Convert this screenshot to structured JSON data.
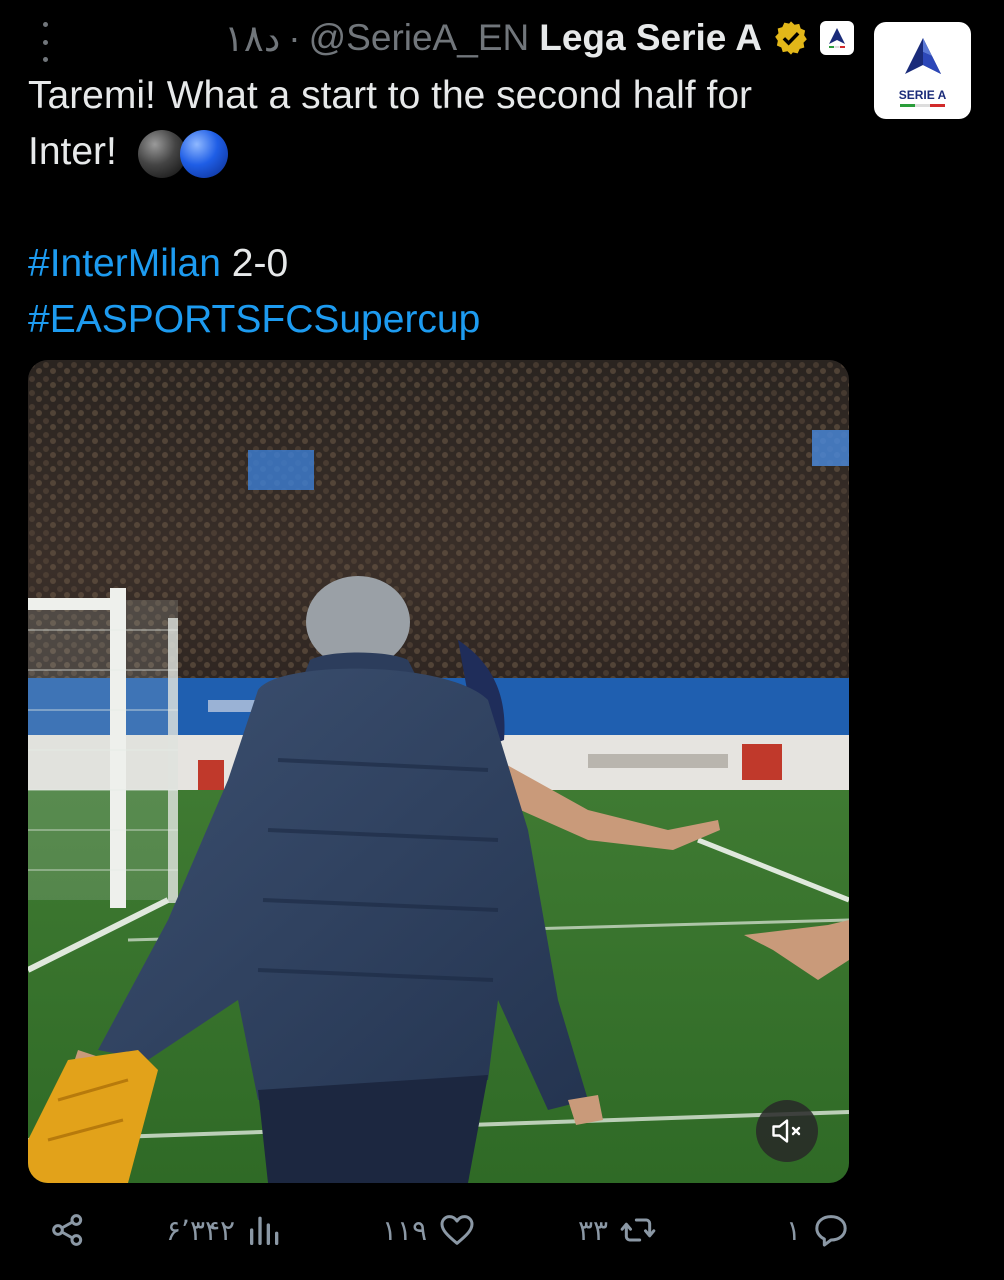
{
  "header": {
    "time": "۱۸د",
    "separator": "·",
    "handle": "@SerieA_EN",
    "display_name": "Lega Serie A"
  },
  "avatar": {
    "label": "SERIE A"
  },
  "tweet": {
    "line1": "Taremi! What a start to the second half for",
    "line2": "Inter!",
    "hashtag1": "#InterMilan",
    "score": " 2-0",
    "hashtag2": "#EASPORTSFCSupercup"
  },
  "actions": {
    "views": "۶٬۳۴۲",
    "likes": "۱۱۹",
    "reposts": "۳۳",
    "replies": "۱"
  },
  "colors": {
    "background": "#000000",
    "link": "#1d9bf0",
    "muted": "#71767b",
    "verified": "#e2b719"
  },
  "icons": [
    "more-vertical-icon",
    "verified-badge-icon",
    "share-icon",
    "views-icon",
    "like-icon",
    "repost-icon",
    "reply-icon",
    "volume-muted-icon"
  ]
}
